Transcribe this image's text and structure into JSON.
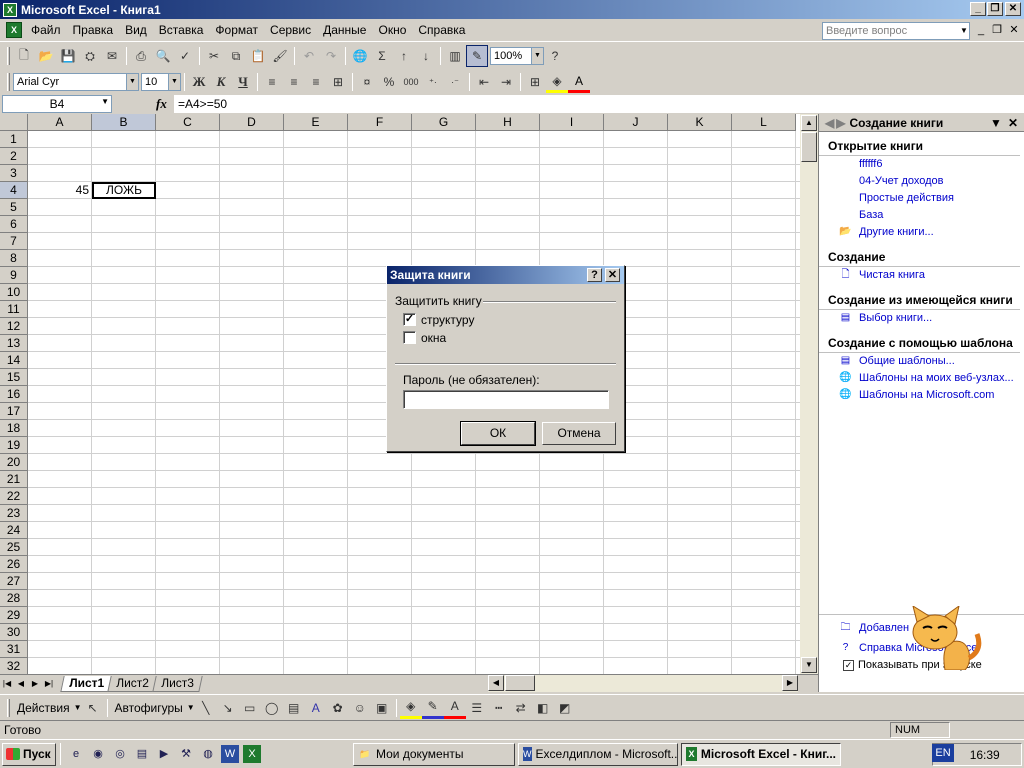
{
  "window": {
    "title": "Microsoft Excel - Книга1"
  },
  "menu": [
    "Файл",
    "Правка",
    "Вид",
    "Вставка",
    "Формат",
    "Сервис",
    "Данные",
    "Окно",
    "Справка"
  ],
  "ask_placeholder": "Введите вопрос",
  "toolbar": {
    "zoom": "100%",
    "font_name": "Arial Cyr",
    "font_size": "10",
    "bold": "Ж",
    "italic": "К",
    "underline": "Ч",
    "percent": "%",
    "thousands": "000",
    "sum": "Σ"
  },
  "formula_bar": {
    "name_box": "B4",
    "fx": "fx",
    "formula": "=A4>=50"
  },
  "columns": [
    "A",
    "B",
    "C",
    "D",
    "E",
    "F",
    "G",
    "H",
    "I",
    "J",
    "K",
    "L"
  ],
  "selected_column": "B",
  "rows": [
    "1",
    "2",
    "3",
    "4",
    "5",
    "6",
    "7",
    "8",
    "9",
    "10",
    "11",
    "12",
    "13",
    "14",
    "15",
    "16",
    "17",
    "18",
    "19",
    "20",
    "21",
    "22",
    "23",
    "24",
    "25",
    "26",
    "27",
    "28",
    "29",
    "30",
    "31",
    "32"
  ],
  "selected_row": "4",
  "cells": {
    "A4": "45",
    "B4": "ЛОЖЬ"
  },
  "sheet_tabs": [
    "Лист1",
    "Лист2",
    "Лист3"
  ],
  "active_sheet": "Лист1",
  "drawing_toolbar": {
    "actions": "Действия",
    "autoshapes": "Автофигуры"
  },
  "status": {
    "text": "Готово",
    "num": "NUM"
  },
  "task_pane": {
    "title": "Создание книги",
    "sections": [
      {
        "title": "Открытие книги",
        "links": [
          "ffffff6",
          "04-Учет доходов",
          "Простые действия",
          "База",
          "Другие книги..."
        ]
      },
      {
        "title": "Создание",
        "links": [
          "Чистая книга"
        ]
      },
      {
        "title": "Создание из имеющейся книги",
        "links": [
          "Выбор книги..."
        ]
      },
      {
        "title": "Создание с помощью шаблона",
        "links": [
          "Общие шаблоны...",
          "Шаблоны на моих веб-узлах...",
          "Шаблоны на Microsoft.com"
        ]
      }
    ],
    "footer": {
      "add": "Добавлен",
      "help": "Справка Microsoft Excel",
      "show": "Показывать при запуске"
    }
  },
  "dialog": {
    "title": "Защита книги",
    "help": "?",
    "close": "✕",
    "group": "Защитить книгу",
    "structure_label": "структуру",
    "structure_checked": true,
    "windows_label": "окна",
    "windows_checked": false,
    "password_label": "Пароль (не обязателен):",
    "password_value": "",
    "ok": "ОК",
    "cancel": "Отмена"
  },
  "taskbar": {
    "start": "Пуск",
    "tasks": [
      "Мои документы",
      "Exceлдиплом - Microsoft...",
      "Microsoft Excel - Книг..."
    ],
    "active_task": 2,
    "lang": "EN",
    "clock": "16:39",
    "tray_arrow": "«"
  },
  "colors": {
    "title_blue": "#0a246a",
    "excel_green": "#1e7a2e",
    "link_blue": "#0000cc"
  }
}
